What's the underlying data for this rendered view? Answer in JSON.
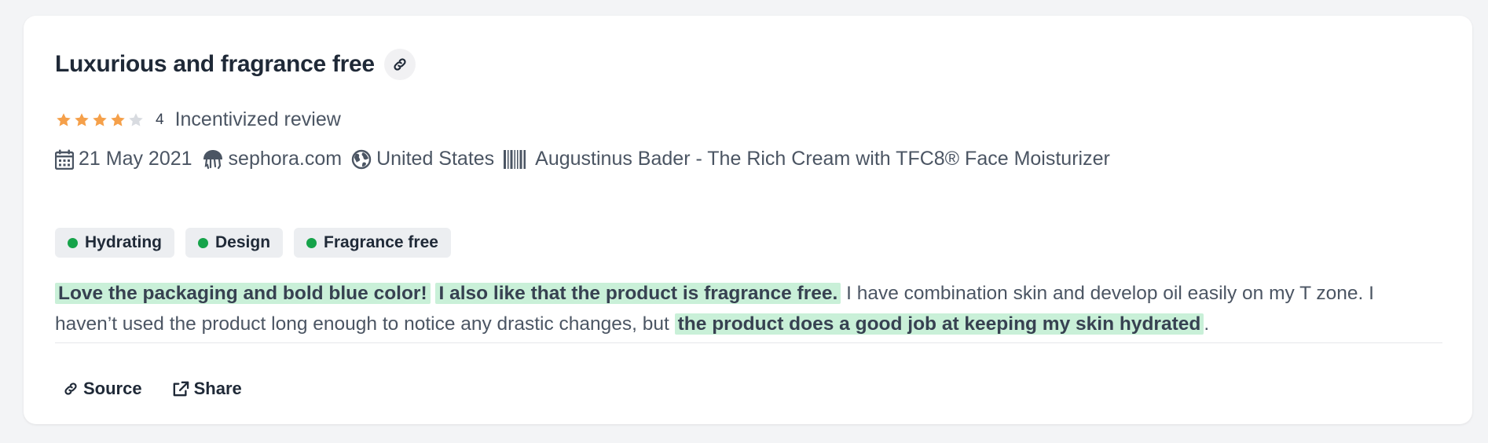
{
  "review": {
    "title": "Luxurious and fragrance free",
    "rating": 4,
    "rating_label": "4",
    "incentive_label": "Incentivized review",
    "date": "21 May 2021",
    "source_site": "sephora.com",
    "country": "United States",
    "product": "Augustinus Bader - The Rich Cream with TFC8® Face Moisturizer",
    "tags": [
      "Hydrating",
      "Design",
      "Fragrance free"
    ],
    "text": {
      "hl1": "Love the packaging and bold blue color!",
      "hl2": "I also like that the product is fragrance free.",
      "plain1": " I have combination skin and develop oil easily on my T zone. I haven’t used the product long enough to notice any drastic changes, but ",
      "hl3": "the product does a good job at keeping my skin hydrated",
      "plain2": "."
    }
  },
  "actions": {
    "source_label": "Source",
    "share_label": "Share"
  },
  "icons": {
    "link": "link-icon",
    "star": "star-icon",
    "calendar": "calendar-icon",
    "site": "jellyfish-icon",
    "country": "globe-icon",
    "product": "barcode-icon",
    "share": "share-icon"
  },
  "colors": {
    "star_filled": "#f5a04a",
    "star_empty": "#d8dbe0",
    "tag_dot": "#16a34a",
    "highlight": "#c9f0d8"
  }
}
